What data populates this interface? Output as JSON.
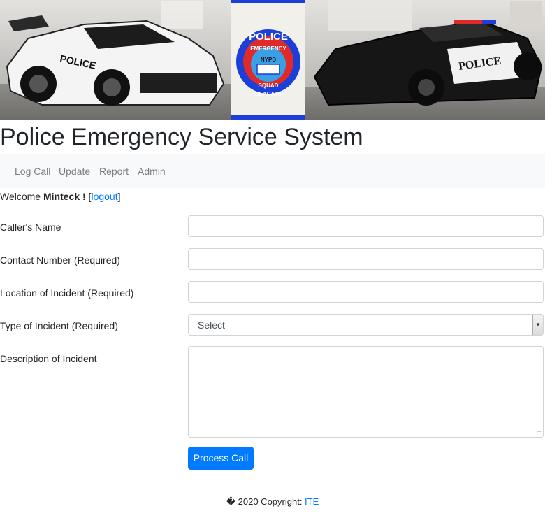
{
  "header": {
    "title": "Police Emergency Service System",
    "logo": {
      "top": "POLICE",
      "ring": "EMERGENCY",
      "center": "NYPD",
      "bottom_ring": "SQUAD",
      "caption": "SEACATS"
    },
    "car_left_lettering": "POLICE",
    "car_right_lettering": "POLICE"
  },
  "nav": {
    "items": [
      "Log Call",
      "Update",
      "Report",
      "Admin"
    ]
  },
  "welcome": {
    "prefix": "Welcome ",
    "user": "Minteck !",
    "open_bracket": " [",
    "logout": "logout",
    "close_bracket": "]"
  },
  "form": {
    "caller_name_label": "Caller's Name",
    "caller_name_value": "",
    "contact_label": "Contact Number (Required)",
    "contact_value": "",
    "location_label": "Location of Incident (Required)",
    "location_value": "",
    "type_label": "Type of Incident (Required)",
    "type_selected": "Select",
    "description_label": "Description of Incident",
    "description_value": "",
    "submit_label": "Process Call"
  },
  "footer": {
    "text": "� 2020 Copyright: ",
    "link": "ITE"
  },
  "colors": {
    "primary": "#007bff",
    "nav_bg": "#f8f9fa",
    "logo_blue": "#1b3fd8",
    "logo_red": "#e02a2a"
  }
}
